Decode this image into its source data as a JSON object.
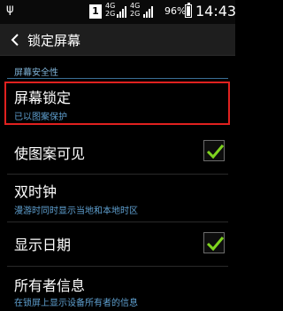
{
  "status_bar": {
    "usb_icon": "usb-icon",
    "badge": "1",
    "net1": [
      "4G",
      "2G"
    ],
    "net2": [
      "4G",
      "2G"
    ],
    "battery": "96%",
    "battery_level": 0.96,
    "time": "14:43"
  },
  "action_bar": {
    "back_icon": "chevron-left-icon",
    "title": "锁定屏幕"
  },
  "section": {
    "header": "屏幕安全性"
  },
  "settings": [
    {
      "title": "屏幕锁定",
      "subtitle": "已以图案保护",
      "highlighted": true
    },
    {
      "title": "使图案可见",
      "checked": true
    },
    {
      "title": "双时钟",
      "subtitle": "漫游时同时显示当地和本地时区"
    },
    {
      "title": "显示日期",
      "checked": true
    },
    {
      "title": "所有者信息",
      "subtitle": "在锁屏上显示设备所有者的信息"
    }
  ],
  "colors": {
    "accent": "#5fa0d0",
    "highlight_border": "#e0211f",
    "check": "#7fd41f"
  }
}
